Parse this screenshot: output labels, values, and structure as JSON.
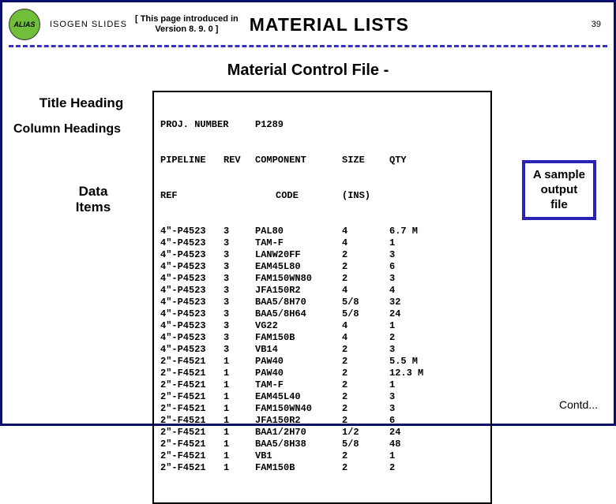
{
  "header": {
    "badge": "ALIAS",
    "isogen": "ISOGEN SLIDES",
    "version_line1": "[ This page introduced in",
    "version_line2": "Version 8. 9. 0 ]",
    "title": "MATERIAL LISTS",
    "page_num": "39"
  },
  "subtitle": "Material Control File -",
  "labels": {
    "title": "Title Heading",
    "columns": "Column Headings",
    "data": "Data\nItems"
  },
  "file": {
    "proj_label": "PROJ. NUMBER",
    "proj_value": "P1289",
    "col_pipeline": "PIPELINE",
    "col_rev": "REV",
    "col_component": "COMPONENT",
    "col_size": "SIZE",
    "col_qty": "QTY",
    "col_ref": "REF",
    "col_code": "CODE",
    "col_ins": "(INS)",
    "rows": [
      {
        "ref": "4\"-P4523",
        "rev": "3",
        "code": "PAL80",
        "size": "4",
        "qty": "6.7 M"
      },
      {
        "ref": "4\"-P4523",
        "rev": "3",
        "code": "TAM-F",
        "size": "4",
        "qty": "1"
      },
      {
        "ref": "4\"-P4523",
        "rev": "3",
        "code": "LANW20FF",
        "size": "2",
        "qty": "3"
      },
      {
        "ref": "4\"-P4523",
        "rev": "3",
        "code": "EAM45L80",
        "size": "2",
        "qty": "6"
      },
      {
        "ref": "4\"-P4523",
        "rev": "3",
        "code": "FAM150WN80",
        "size": "2",
        "qty": "3"
      },
      {
        "ref": "4\"-P4523",
        "rev": "3",
        "code": "JFA150R2",
        "size": "4",
        "qty": "4"
      },
      {
        "ref": "4\"-P4523",
        "rev": "3",
        "code": "BAA5/8H70",
        "size": "5/8",
        "qty": "32"
      },
      {
        "ref": "4\"-P4523",
        "rev": "3",
        "code": "BAA5/8H64",
        "size": "5/8",
        "qty": "24"
      },
      {
        "ref": "4\"-P4523",
        "rev": "3",
        "code": "VG22",
        "size": "4",
        "qty": "1"
      },
      {
        "ref": "4\"-P4523",
        "rev": "3",
        "code": "FAM150B",
        "size": "4",
        "qty": "2"
      },
      {
        "ref": "4\"-P4523",
        "rev": "3",
        "code": "VB14",
        "size": "2",
        "qty": "3"
      },
      {
        "ref": "2\"-F4521",
        "rev": "1",
        "code": "PAW40",
        "size": "2",
        "qty": "5.5 M"
      },
      {
        "ref": "2\"-F4521",
        "rev": "1",
        "code": "PAW40",
        "size": "2",
        "qty": "12.3 M"
      },
      {
        "ref": "2\"-F4521",
        "rev": "1",
        "code": "TAM-F",
        "size": "2",
        "qty": "1"
      },
      {
        "ref": "2\"-F4521",
        "rev": "1",
        "code": "EAM45L40",
        "size": "2",
        "qty": "3"
      },
      {
        "ref": "2\"-F4521",
        "rev": "1",
        "code": "FAM150WN40",
        "size": "2",
        "qty": "3"
      },
      {
        "ref": "2\"-F4521",
        "rev": "1",
        "code": "JFA150R2",
        "size": "2",
        "qty": "6"
      },
      {
        "ref": "2\"-F4521",
        "rev": "1",
        "code": "BAA1/2H70",
        "size": "1/2",
        "qty": "24"
      },
      {
        "ref": "2\"-F4521",
        "rev": "1",
        "code": "BAA5/8H38",
        "size": "5/8",
        "qty": "48"
      },
      {
        "ref": "2\"-F4521",
        "rev": "1",
        "code": "VB1",
        "size": "2",
        "qty": "1"
      },
      {
        "ref": "2\"-F4521",
        "rev": "1",
        "code": "FAM150B",
        "size": "2",
        "qty": "2"
      }
    ]
  },
  "annotation": "A sample\noutput\nfile",
  "contd": "Contd..."
}
